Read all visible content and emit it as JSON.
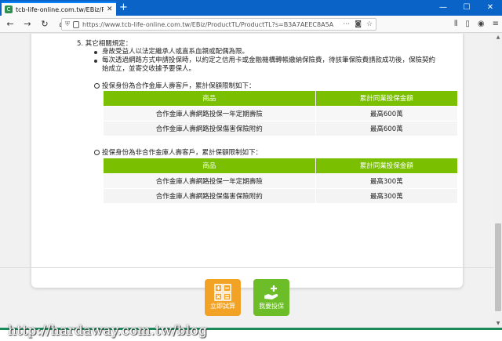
{
  "browser": {
    "tab_title": "tcb-life-online.com.tw/EBiz/P",
    "favicon_label": "C",
    "tab_close": "✕",
    "new_tab": "+",
    "window_controls": [
      "—",
      "☐",
      "✕"
    ],
    "url": "https://www.tcb-life-online.com.tw/EBiz/ProductTL/ProductTL?s=B3A7AEEC8A5AD67"
  },
  "content": {
    "section_title": "5. 其它相關規定：",
    "bullets": [
      "身故受益人以法定繼承人或直系血親或配偶為限。",
      "每次透過網路方式申請投保時，以約定之信用卡或金融機構轉帳繳納保險費，待該筆保險費請款成功後，保險契約始成立，並寄交收據予要保人。"
    ],
    "limit_table_1": {
      "title": "投保身份為合作金庫人壽客戶，累計保額限制如下：",
      "headers": [
        "商品",
        "累計同業投保金額"
      ],
      "rows": [
        [
          "合作金庫人壽網路投保一年定期壽險",
          "最高600萬"
        ],
        [
          "合作金庫人壽網路投保傷害保險附約",
          "最高600萬"
        ]
      ]
    },
    "limit_table_2": {
      "title": "投保身份為非合作金庫人壽客戶，累計保額限制如下：",
      "headers": [
        "商品",
        "累計同業投保金額"
      ],
      "rows": [
        [
          "合作金庫人壽網路投保一年定期壽險",
          "最高300萬"
        ],
        [
          "合作金庫人壽網路投保傷害保險附約",
          "最高300萬"
        ]
      ]
    }
  },
  "actions": {
    "calc_label": "立即試算",
    "insure_label": "我要投保"
  },
  "colors": {
    "table_header": "#7ac000",
    "calc_button": "#f2a325",
    "insure_button": "#6cbd27"
  },
  "watermark": "http://hardaway.com.tw/blog"
}
